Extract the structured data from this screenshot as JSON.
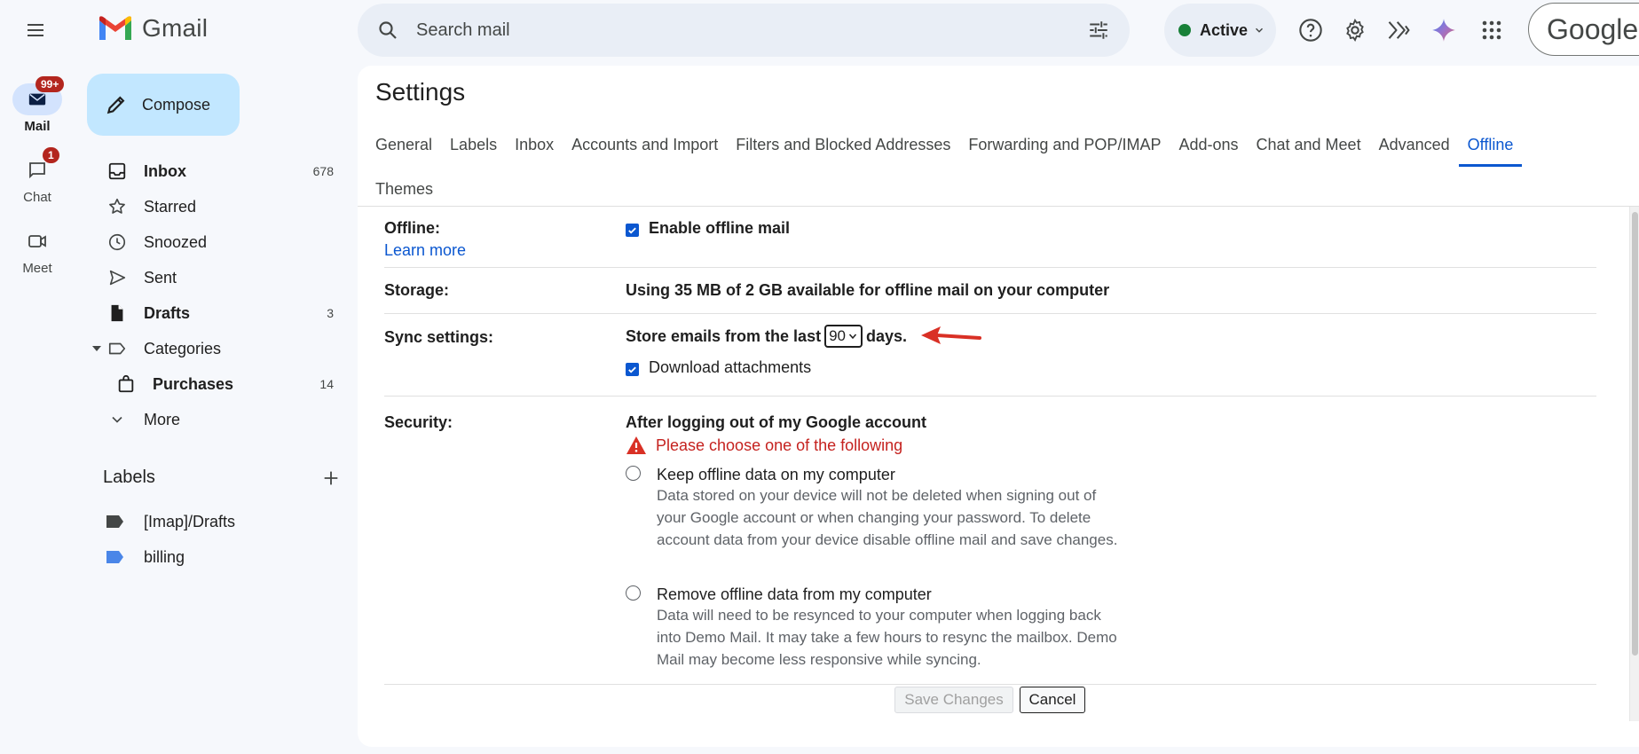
{
  "rail": {
    "mail": {
      "label": "Mail",
      "badge": "99+"
    },
    "chat": {
      "label": "Chat",
      "badge": "1"
    },
    "meet": {
      "label": "Meet"
    }
  },
  "header": {
    "app_name": "Gmail",
    "search_placeholder": "Search mail",
    "status": "Active",
    "account_brand": "Google"
  },
  "sidebar": {
    "compose": "Compose",
    "items": [
      {
        "label": "Inbox",
        "count": "678",
        "icon": "inbox-icon",
        "bold": true
      },
      {
        "label": "Starred",
        "count": "",
        "icon": "star-icon"
      },
      {
        "label": "Snoozed",
        "count": "",
        "icon": "clock-icon"
      },
      {
        "label": "Sent",
        "count": "",
        "icon": "send-icon"
      },
      {
        "label": "Drafts",
        "count": "3",
        "icon": "draft-icon",
        "bold": true
      },
      {
        "label": "Categories",
        "count": "",
        "icon": "label-outline-icon"
      },
      {
        "label": "Purchases",
        "count": "14",
        "icon": "shopping-bag-icon",
        "bold": true
      },
      {
        "label": "More",
        "count": "",
        "icon": "chevron-down-icon"
      }
    ],
    "labels_title": "Labels",
    "labels": [
      {
        "name": "[Imap]/Drafts",
        "color": "#444746"
      },
      {
        "name": "billing",
        "color": "#4a86e8"
      }
    ]
  },
  "settings": {
    "title": "Settings",
    "tabs_row1": [
      "General",
      "Labels",
      "Inbox",
      "Accounts and Import",
      "Filters and Blocked Addresses",
      "Forwarding and POP/IMAP",
      "Add-ons",
      "Chat and Meet",
      "Advanced",
      "Offline"
    ],
    "tabs_row2": [
      "Themes"
    ],
    "active_tab": "Offline",
    "offline": {
      "label": "Offline:",
      "learn_more": "Learn more",
      "enable_label": "Enable offline mail",
      "enable_checked": true
    },
    "storage": {
      "label": "Storage:",
      "text": "Using 35 MB of 2 GB available for offline mail on your computer"
    },
    "sync": {
      "label": "Sync settings:",
      "prefix": "Store emails from the last",
      "days_value": "90",
      "suffix": "days.",
      "download_label": "Download attachments",
      "download_checked": true
    },
    "security": {
      "label": "Security:",
      "heading": "After logging out of my Google account",
      "warning": "Please choose one of the following",
      "option1_title": "Keep offline data on my computer",
      "option1_desc": "Data stored on your device will not be deleted when signing out of your Google account or when changing your password. To delete account data from your device disable offline mail and save changes.",
      "option2_title": "Remove offline data from my computer",
      "option2_desc": "Data will need to be resynced to your computer when logging back into Demo Mail. It may take a few hours to resync the mailbox. Demo Mail may become less responsive while syncing."
    },
    "save_label": "Save Changes",
    "cancel_label": "Cancel"
  },
  "colors": {
    "accent": "#0b57d0",
    "compose_bg": "#c2e7ff",
    "warning": "#c5221f",
    "status_green": "#188038",
    "annotation_arrow": "#d93025"
  }
}
